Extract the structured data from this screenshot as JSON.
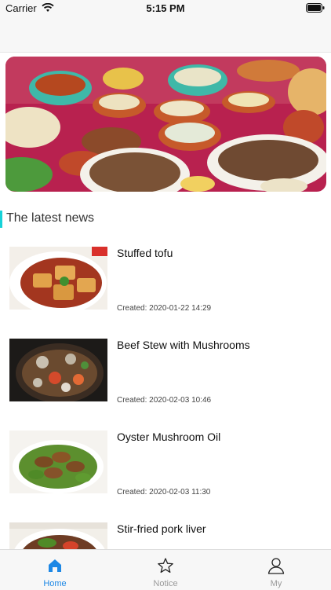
{
  "status_bar": {
    "carrier": "Carrier",
    "time": "5:15 PM"
  },
  "section": {
    "title": "The latest news"
  },
  "news": [
    {
      "title": "Stuffed tofu",
      "created": "Created: 2020-01-22 14:29"
    },
    {
      "title": "Beef Stew with Mushrooms",
      "created": "Created: 2020-02-03 10:46"
    },
    {
      "title": "Oyster Mushroom Oil",
      "created": "Created: 2020-02-03 11:30"
    },
    {
      "title": "Stir-fried pork liver",
      "created": ""
    }
  ],
  "tab_bar": {
    "items": [
      {
        "label": "Home",
        "icon": "home-icon",
        "active": true
      },
      {
        "label": "Notice",
        "icon": "star-icon",
        "active": false
      },
      {
        "label": "My",
        "icon": "person-icon",
        "active": false
      }
    ]
  },
  "colors": {
    "accent": "#1e88e5",
    "section_bar": "#16d2d8"
  }
}
